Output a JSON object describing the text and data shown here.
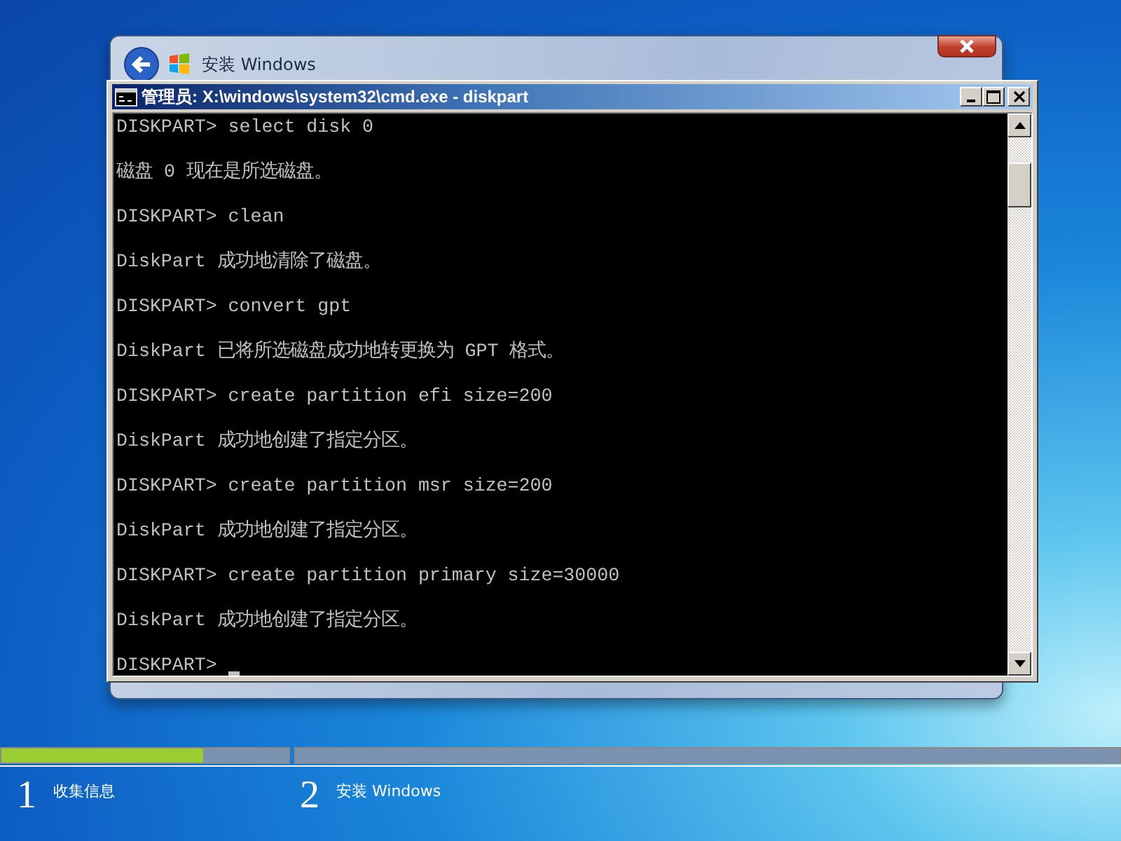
{
  "setup_window": {
    "title": "安装 Windows"
  },
  "console_window": {
    "title": "管理员: X:\\windows\\system32\\cmd.exe - diskpart",
    "blocks": [
      {
        "command": "DISKPART> select disk 0",
        "output": "磁盘 0 现在是所选磁盘。"
      },
      {
        "command": "DISKPART> clean",
        "output": "DiskPart 成功地清除了磁盘。"
      },
      {
        "command": "DISKPART> convert gpt",
        "output": "DiskPart 已将所选磁盘成功地转更换为 GPT 格式。"
      },
      {
        "command": "DISKPART> create partition efi size=200",
        "output": "DiskPart 成功地创建了指定分区。"
      },
      {
        "command": "DISKPART> create partition msr size=200",
        "output": "DiskPart 成功地创建了指定分区。"
      },
      {
        "command": "DISKPART> create partition primary size=30000",
        "output": "DiskPart 成功地创建了指定分区。"
      },
      {
        "command": "DISKPART>"
      }
    ]
  },
  "steps": [
    {
      "number": "1",
      "label": "收集信息",
      "level": 0.7
    },
    {
      "number": "2",
      "label": "安装 Windows"
    }
  ]
}
